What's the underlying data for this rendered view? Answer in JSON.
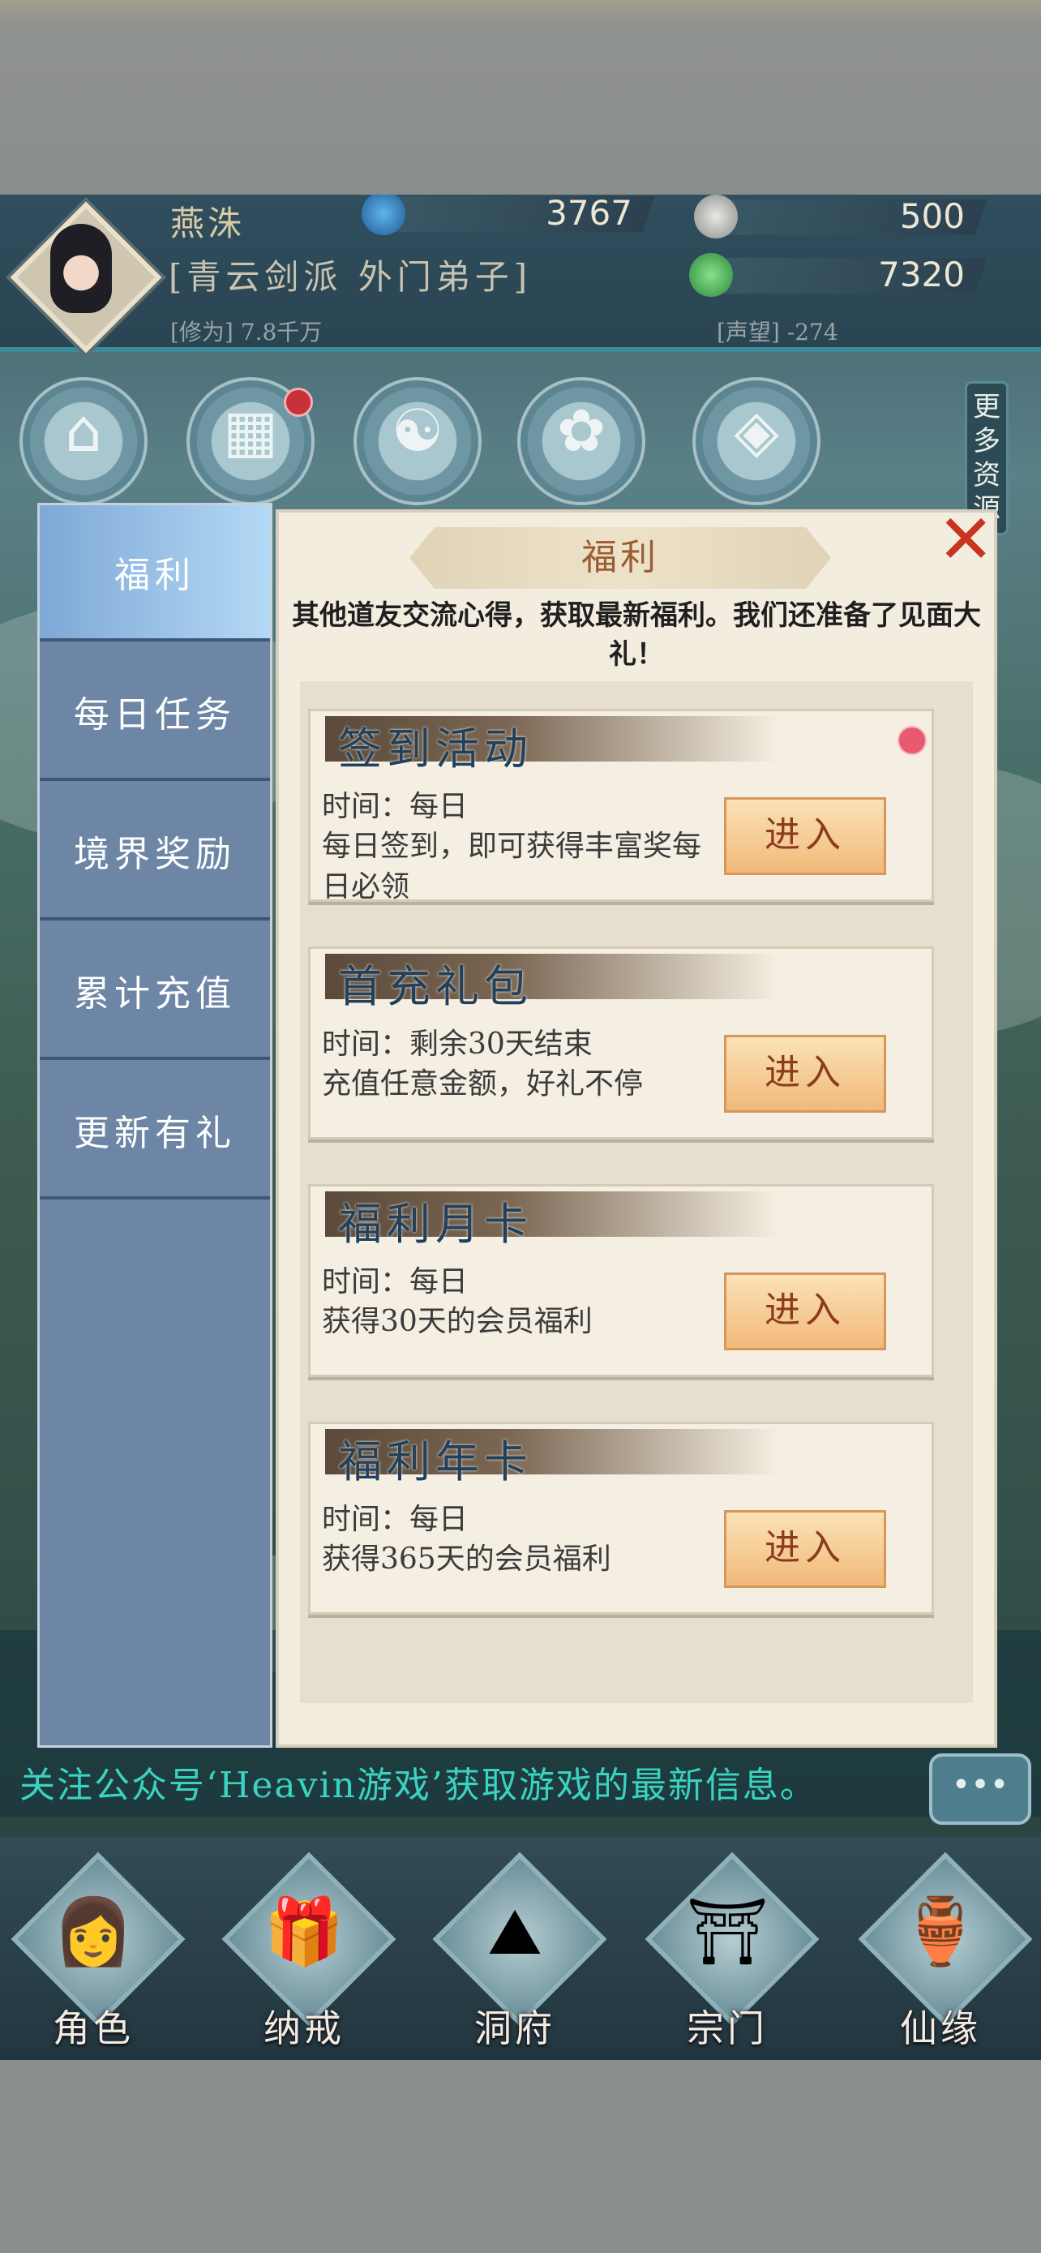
{
  "header": {
    "player_name": "燕洙",
    "sect": "[青云剑派 外门弟子]",
    "cultivation": "[修为] 7.8千万",
    "reputation": "[声望] -274",
    "currency_jade": "3767",
    "currency_silver": "500",
    "currency_spirit": "7320",
    "more_resources": "更多资源"
  },
  "panel": {
    "title": "福利",
    "notice": "其他道友交流心得，获取最新福利。我们还准备了见面大礼！"
  },
  "tabs": [
    {
      "label": "福利"
    },
    {
      "label": "每日任务"
    },
    {
      "label": "境界奖励"
    },
    {
      "label": "累计充值"
    },
    {
      "label": "更新有礼"
    }
  ],
  "cards": [
    {
      "title": "签到活动",
      "line1": "时间：每日",
      "line2": "每日签到，即可获得丰富奖每日必领",
      "button": "进入"
    },
    {
      "title": "首充礼包",
      "line1": "时间：剩余30天结束",
      "line2": "充值任意金额，好礼不停",
      "button": "进入"
    },
    {
      "title": "福利月卡",
      "line1": "时间：每日",
      "line2": "获得30天的会员福利",
      "button": "进入"
    },
    {
      "title": "福利年卡",
      "line1": "时间：每日",
      "line2": "获得365天的会员福利",
      "button": "进入"
    }
  ],
  "chat": {
    "message": "关注公众号‘Heavin游戏’获取游戏的最新信息。",
    "button": "•••"
  },
  "bottom_nav": [
    {
      "label": "角色"
    },
    {
      "label": "纳戒"
    },
    {
      "label": "洞府"
    },
    {
      "label": "宗门"
    },
    {
      "label": "仙缘"
    }
  ],
  "icons": {
    "top_nav": [
      "pavilion-icon",
      "gift-icon",
      "taiji-icon",
      "lotus-icon",
      "realm-icon"
    ],
    "bottom_nav": [
      "avatar-icon",
      "ring-bag-icon",
      "cave-icon",
      "sect-icon",
      "gourd-icon"
    ]
  },
  "colors": {
    "tab_active": "#9ec6ea",
    "tab_bg": "#6d86a5",
    "card_title": "#22405a",
    "close": "#c8341f",
    "chat_text": "#39d3c2",
    "notification": "#e85a72"
  }
}
